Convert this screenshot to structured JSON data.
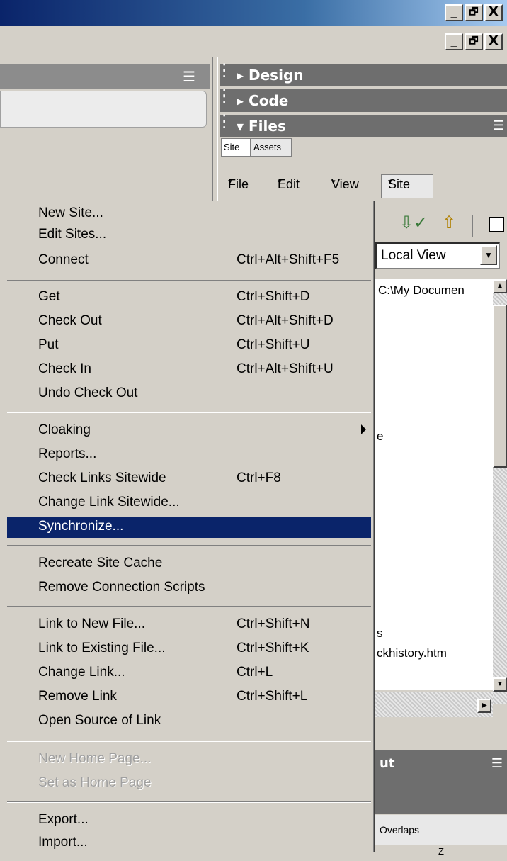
{
  "window": {
    "controls": {
      "minimize": "_",
      "restore": "🗗",
      "close": "X"
    }
  },
  "right_panel": {
    "design_label": "Design",
    "code_label": "Code",
    "files_label": "Files",
    "tabs": {
      "site": "Site",
      "assets": "Assets"
    },
    "menu": {
      "file": "File",
      "edit": "Edit",
      "view": "View",
      "site": "Site"
    },
    "view_select": "Local View",
    "path": "C:\\My Documen",
    "file_partial_1": "e",
    "file_partial_2": "s",
    "file_partial_3": "ckhistory.htm",
    "props_title": "ut",
    "overlaps": "Overlaps",
    "z_col": "Z"
  },
  "context_menu": {
    "items": [
      {
        "label": "New Site...",
        "shortcut": ""
      },
      {
        "label": "Edit Sites...",
        "shortcut": ""
      },
      {
        "label": "Connect",
        "shortcut": "Ctrl+Alt+Shift+F5"
      },
      {
        "label": "Get",
        "shortcut": "Ctrl+Shift+D"
      },
      {
        "label": "Check Out",
        "shortcut": "Ctrl+Alt+Shift+D"
      },
      {
        "label": "Put",
        "shortcut": "Ctrl+Shift+U"
      },
      {
        "label": "Check In",
        "shortcut": "Ctrl+Alt+Shift+U"
      },
      {
        "label": "Undo Check Out",
        "shortcut": ""
      },
      {
        "label": "Cloaking",
        "shortcut": ""
      },
      {
        "label": "Reports...",
        "shortcut": ""
      },
      {
        "label": "Check Links Sitewide",
        "shortcut": "Ctrl+F8"
      },
      {
        "label": "Change Link Sitewide...",
        "shortcut": ""
      },
      {
        "label": "Synchronize...",
        "shortcut": ""
      },
      {
        "label": "Recreate Site Cache",
        "shortcut": ""
      },
      {
        "label": "Remove Connection Scripts",
        "shortcut": ""
      },
      {
        "label": "Link to New File...",
        "shortcut": "Ctrl+Shift+N"
      },
      {
        "label": "Link to Existing File...",
        "shortcut": "Ctrl+Shift+K"
      },
      {
        "label": "Change Link...",
        "shortcut": "Ctrl+L"
      },
      {
        "label": "Remove Link",
        "shortcut": "Ctrl+Shift+L"
      },
      {
        "label": "Open Source of Link",
        "shortcut": ""
      },
      {
        "label": "New Home Page...",
        "shortcut": ""
      },
      {
        "label": "Set as Home Page",
        "shortcut": ""
      },
      {
        "label": "Export...",
        "shortcut": ""
      },
      {
        "label": "Import...",
        "shortcut": ""
      }
    ],
    "highlighted_item": "Synchronize...",
    "highlight_color": "#0a246a"
  },
  "icons": [
    "panel-options-icon",
    "get-files-icon",
    "put-files-icon",
    "expand-icon",
    "dropdown-arrow-icon",
    "submenu-arrow-icon"
  ]
}
